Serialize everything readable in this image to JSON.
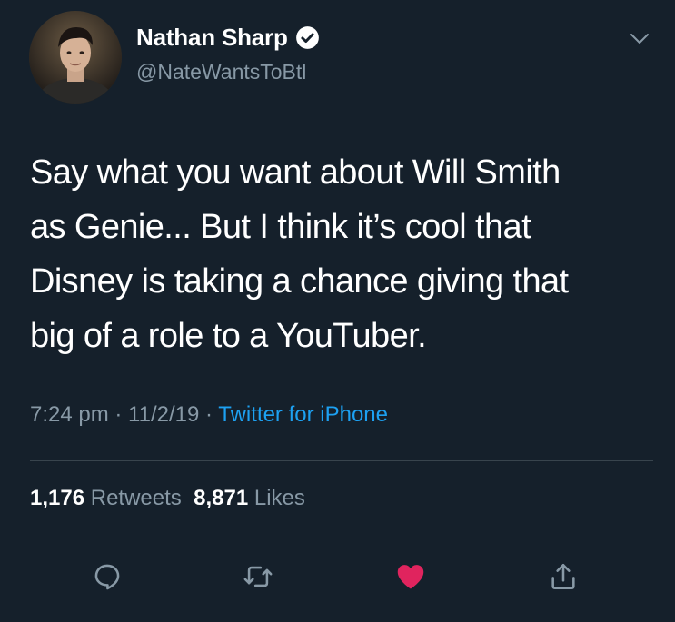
{
  "author": {
    "display_name": "Nathan Sharp",
    "handle": "@NateWantsToBtl",
    "verified": true
  },
  "tweet": {
    "text": "Say what you want about Will Smith\nas Genie... But I think it’s cool that\nDisney is taking a chance giving that\nbig of a role to a YouTuber.",
    "time": "7:24 pm",
    "date": "11/2/19",
    "source": "Twitter for iPhone",
    "separator": " · "
  },
  "stats": {
    "retweets_count": "1,176",
    "retweets_label": "Retweets",
    "likes_count": "8,871",
    "likes_label": "Likes"
  },
  "actions": {
    "icons": [
      "reply-icon",
      "retweet-icon",
      "like-icon",
      "share-icon"
    ],
    "liked": true
  },
  "colors": {
    "background": "#15202b",
    "text": "#ffffff",
    "secondary_text": "#8899a6",
    "link": "#1da1f2",
    "divider": "#38444d",
    "like_active": "#e0245e"
  }
}
